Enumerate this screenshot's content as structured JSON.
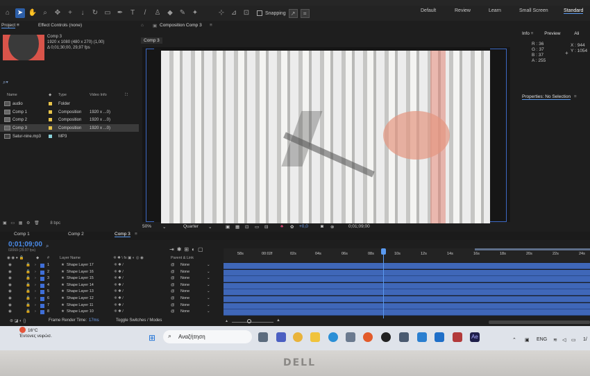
{
  "workspaces": {
    "default": "Default",
    "review": "Review",
    "learn": "Learn",
    "small_screen": "Small Screen",
    "standard": "Standard"
  },
  "toolbar": {
    "snapping": "Snapping"
  },
  "project_panel": {
    "tab_project": "Project",
    "tab_effect_controls": "Effect Controls (none)",
    "selected_comp": "Comp 3",
    "resolution_line": "1920 x 1080  (480 x 270) (1,00)",
    "duration_line": "Δ 0;01;30;00, 29,97 fps",
    "columns": {
      "name": "Name",
      "type": "Type",
      "video_info": "Video Info"
    },
    "items": [
      {
        "name": "audio",
        "type": "Folder",
        "info": "",
        "color": "#e8c44a"
      },
      {
        "name": "Comp 1",
        "type": "Composition",
        "info": "1920 x ...0)",
        "color": "#e8c44a"
      },
      {
        "name": "Comp 2",
        "type": "Composition",
        "info": "1920 x ...0)",
        "color": "#e8c44a"
      },
      {
        "name": "Comp 3",
        "type": "Composition",
        "info": "1920 x ...0)",
        "color": "#e8c44a"
      },
      {
        "name": "Satur-nine.mp3",
        "type": "MP3",
        "info": "",
        "color": "#8ad0d8"
      }
    ],
    "bit_depth": "8 bpc"
  },
  "viewer": {
    "panel_title": "Composition Comp 3",
    "comp_tab": "Comp 3",
    "zoom": "50%",
    "quality": "Quarter",
    "exposure": "+0,0",
    "timecode": "0;01;09;00"
  },
  "info_panel": {
    "tab_info": "Info",
    "tab_preview": "Preview",
    "tab_align": "Ali",
    "r": "R : 36",
    "g": "G : 37",
    "b": "B : 37",
    "a": "A : 255",
    "x": "X : 944",
    "y": "Y : 1054",
    "properties": "Properties: No Selection"
  },
  "timeline": {
    "tabs": [
      "Comp 1",
      "Comp 2",
      "Comp 3"
    ],
    "current_time": "0;01;09;00",
    "fps_note": "02069 (29.97 fps)",
    "col_layer_name": "Layer Name",
    "col_parent": "Parent & Link",
    "ruler_labels": [
      "58s",
      "00:02f",
      "02s",
      "04s",
      "06s",
      "08s",
      "10s",
      "12s",
      "14s",
      "16s",
      "18s",
      "20s",
      "22s",
      "24s"
    ],
    "layers": [
      {
        "num": "1",
        "name": "Shape Layer 17",
        "parent": "None"
      },
      {
        "num": "2",
        "name": "Shape Layer 16",
        "parent": "None"
      },
      {
        "num": "3",
        "name": "Shape Layer 15",
        "parent": "None"
      },
      {
        "num": "4",
        "name": "Shape Layer 14",
        "parent": "None"
      },
      {
        "num": "5",
        "name": "Shape Layer 13",
        "parent": "None"
      },
      {
        "num": "6",
        "name": "Shape Layer 12",
        "parent": "None"
      },
      {
        "num": "7",
        "name": "Shape Layer 11",
        "parent": "None"
      },
      {
        "num": "8",
        "name": "Shape Layer 10",
        "parent": "None"
      }
    ],
    "frame_render_label": "Frame Render Time:",
    "frame_render_value": "17ms",
    "toggle_label": "Toggle Switches / Modes"
  },
  "taskbar": {
    "temperature": "16°C",
    "weather": "Έντονες νεφώσ.",
    "search": "Αναζήτηση",
    "language": "ENG",
    "clock": "1/"
  },
  "brand": "DELL"
}
